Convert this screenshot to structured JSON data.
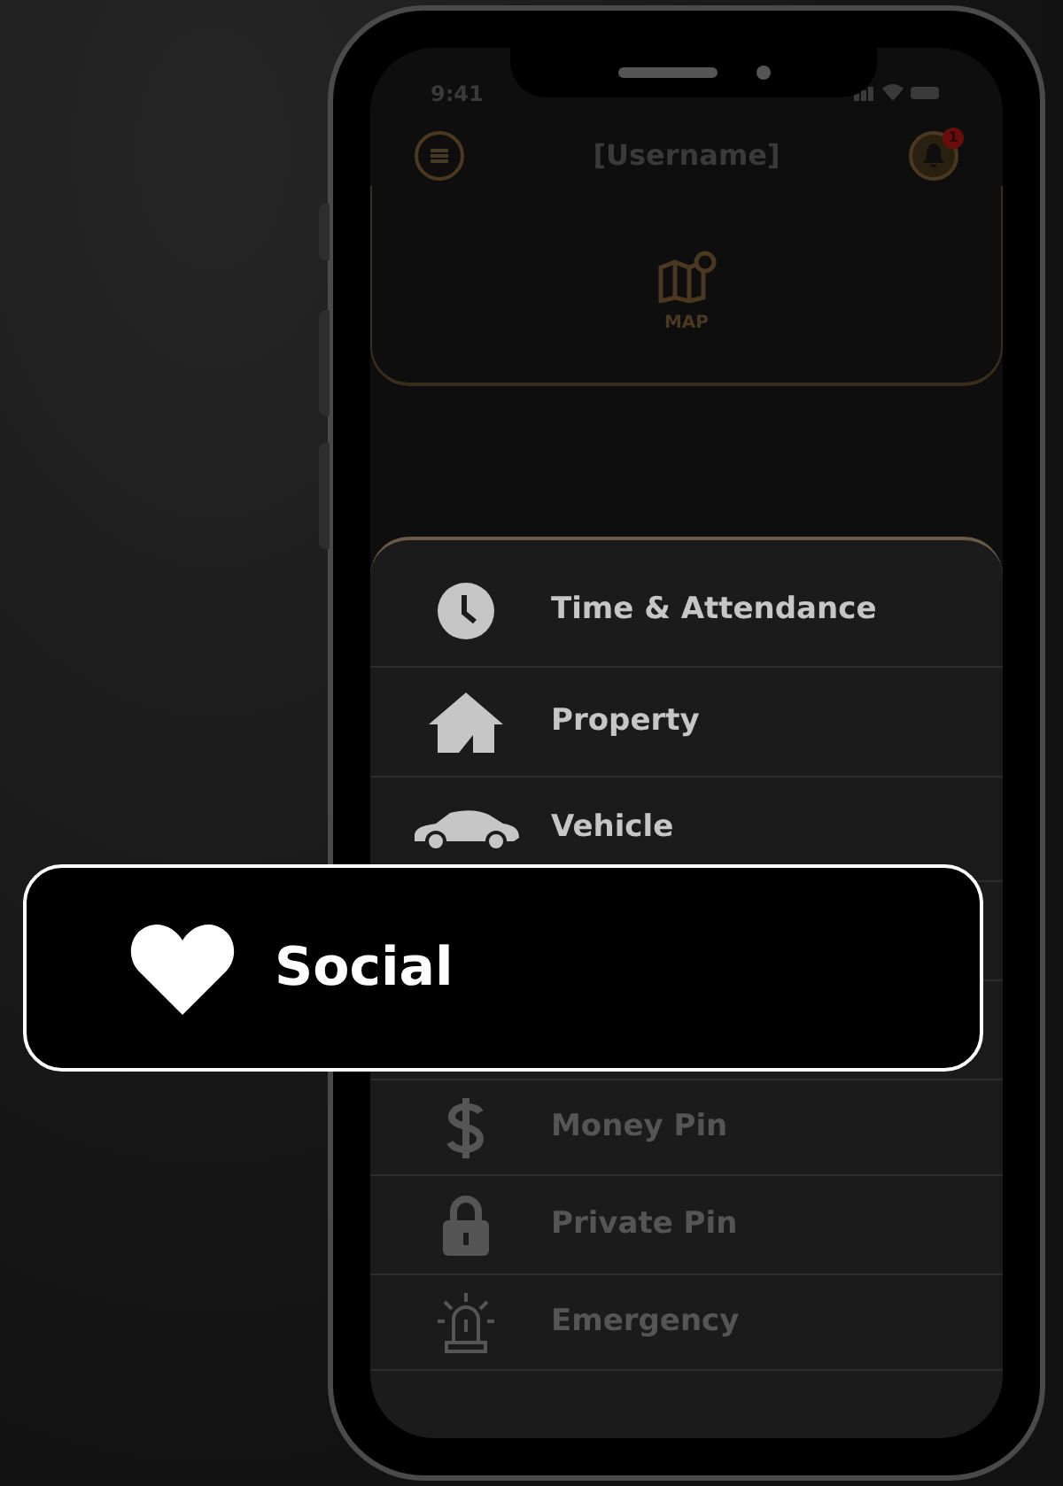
{
  "status_bar": {
    "time": "9:41"
  },
  "header": {
    "title": "[Username]",
    "notification_count": "1"
  },
  "map_card": {
    "label": "MAP"
  },
  "menu": {
    "items_top": [
      {
        "kind": "clock",
        "label": "Time & Attendance",
        "disabled": false
      },
      {
        "kind": "house",
        "label": "Property",
        "disabled": false
      },
      {
        "kind": "car",
        "label": "Vehicle",
        "disabled": false
      }
    ],
    "items_bottom": [
      {
        "kind": "dollar",
        "label": "Money Pin",
        "disabled": true
      },
      {
        "kind": "lock",
        "label": "Private Pin",
        "disabled": true
      },
      {
        "kind": "siren",
        "label": "Emergency",
        "disabled": true
      }
    ]
  },
  "callout": {
    "label": "Social"
  }
}
